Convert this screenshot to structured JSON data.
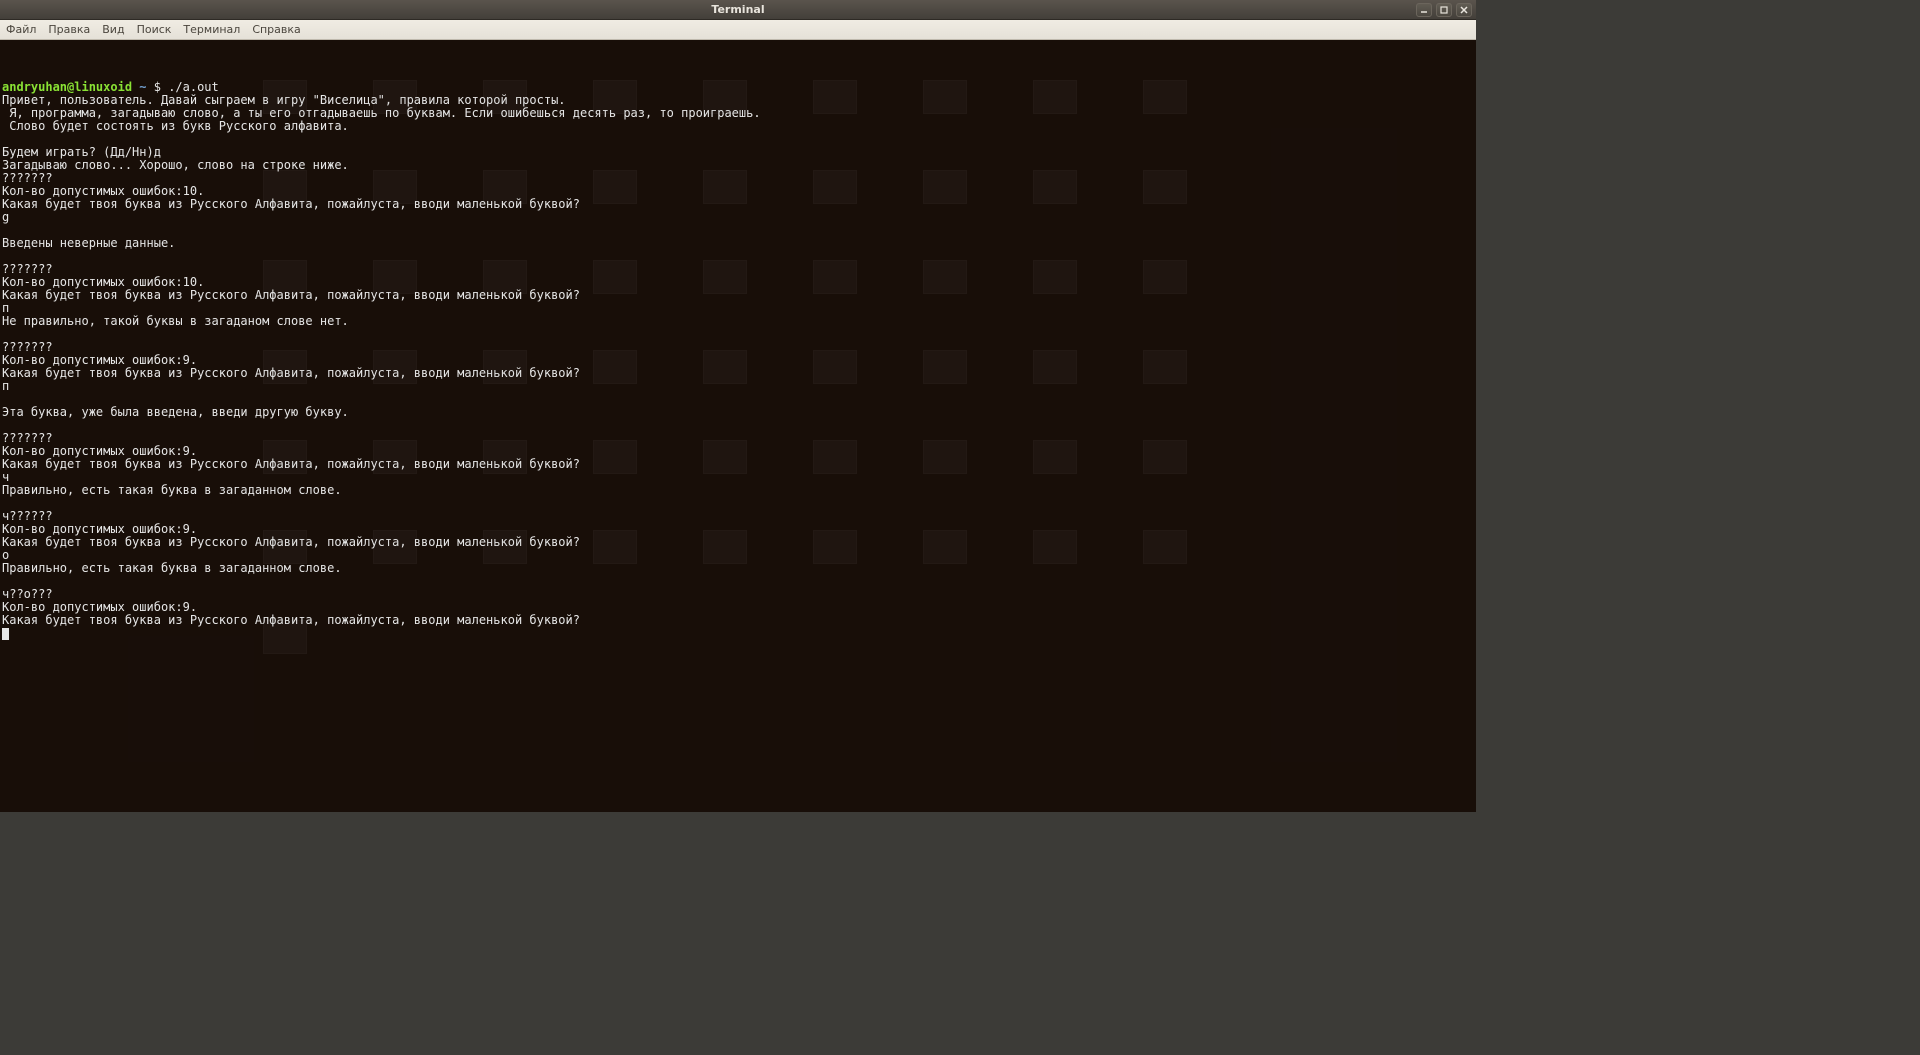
{
  "window": {
    "title": "Terminal"
  },
  "menubar": {
    "items": [
      "Файл",
      "Правка",
      "Вид",
      "Поиск",
      "Терминал",
      "Справка"
    ]
  },
  "prompt": {
    "user_host": "andryuhan@linuxoid",
    "separator": " ~ $ ",
    "command": "./a.out"
  },
  "terminal_lines": [
    "Привет, пользователь. Давай сыграем в игру \"Виселица\", правила которой просты.",
    " Я, программа, загадываю слово, а ты его отгадываешь по буквам. Если ошибешься десять раз, то проиграешь.",
    " Слово будет состоять из букв Русского алфавита.",
    "",
    "Будем играть? (Дд/Нн)д",
    "Загадываю слово... Хорошо, слово на строке ниже.",
    "???????",
    "Кол-во допустимых ошибок:10.",
    "Какая будет твоя буква из Русского Алфавита, пожайлуста, вводи маленькой буквой?",
    "g",
    "",
    "Введены неверные данные.",
    "",
    "???????",
    "Кол-во допустимых ошибок:10.",
    "Какая будет твоя буква из Русского Алфавита, пожайлуста, вводи маленькой буквой?",
    "п",
    "Не правильно, такой буквы в загаданом слове нет.",
    "",
    "???????",
    "Кол-во допустимых ошибок:9.",
    "Какая будет твоя буква из Русского Алфавита, пожайлуста, вводи маленькой буквой?",
    "п",
    "",
    "Эта буква, уже была введена, введи другую букву.",
    "",
    "???????",
    "Кол-во допустимых ошибок:9.",
    "Какая будет твоя буква из Русского Алфавита, пожайлуста, вводи маленькой буквой?",
    "ч",
    "Правильно, есть такая буква в загаданном слове.",
    "",
    "ч??????",
    "Кол-во допустимых ошибок:9.",
    "Какая будет твоя буква из Русского Алфавита, пожайлуста, вводи маленькой буквой?",
    "о",
    "Правильно, есть такая буква в загаданном слове.",
    "",
    "ч??о???",
    "Кол-во допустимых ошибок:9.",
    "Какая будет твоя буква из Русского Алфавита, пожайлуста, вводи маленькой буквой?"
  ]
}
